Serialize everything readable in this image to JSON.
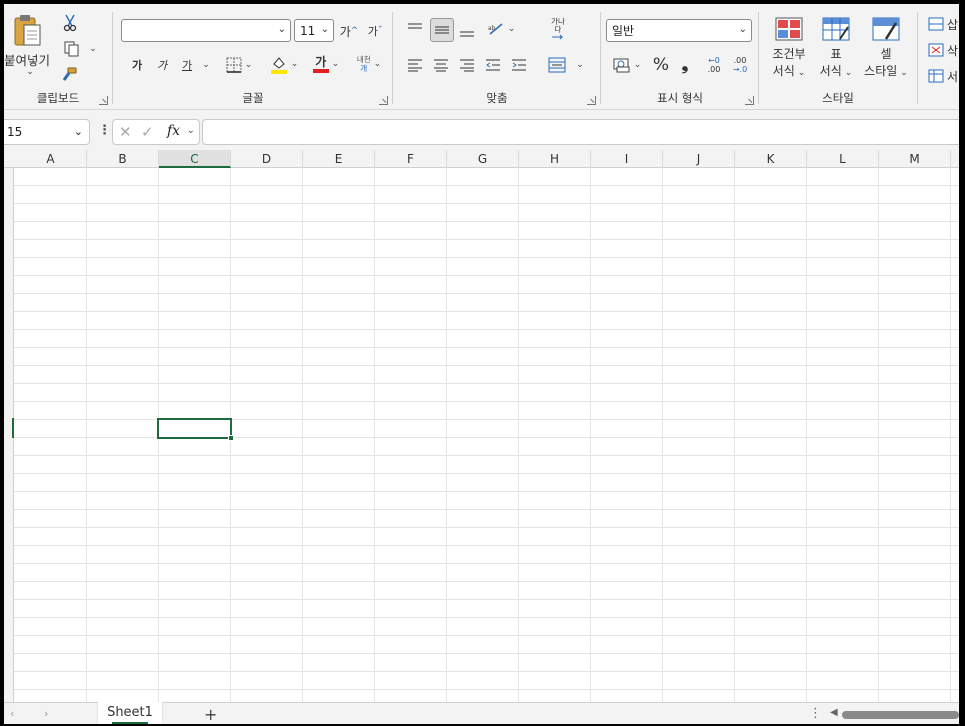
{
  "clipboard": {
    "paste_label": "붙여넣기",
    "group_label": "클립보드"
  },
  "font": {
    "family_value": "",
    "size_value": "11",
    "grow_label": "가",
    "shrink_label": "가",
    "bold_label": "가",
    "italic_label": "가",
    "underline_label": "가",
    "fontcolor_label": "가",
    "phonetic_label": "내천",
    "group_label": "글꼴"
  },
  "alignment": {
    "wrap_label": "가나다",
    "group_label": "맞춤"
  },
  "number": {
    "format_value": "일반",
    "percent_label": "%",
    "comma_label": "❟",
    "inc_decimal_label": ".00",
    "dec_decimal_label": ".0",
    "group_label": "표시 형식"
  },
  "styles": {
    "conditional_label_1": "조건부",
    "conditional_label_2": "서식",
    "table_label_1": "표",
    "table_label_2": "서식",
    "cell_label_1": "셀",
    "cell_label_2": "스타일",
    "group_label": "스타일"
  },
  "cells": {
    "insert_label": "삽",
    "delete_label": "삭",
    "format_label": "서"
  },
  "formula_bar": {
    "name_box_value": "15",
    "formula_value": "",
    "fx_label": "fx"
  },
  "columns": [
    "A",
    "B",
    "C",
    "D",
    "E",
    "F",
    "G",
    "H",
    "I",
    "J",
    "K",
    "L",
    "M"
  ],
  "selected_column": "C",
  "sheets": {
    "active_tab": "Sheet1",
    "add_label": "+"
  },
  "colors": {
    "accent": "#1e6b41",
    "fill_yellow": "#ffe600",
    "font_red": "#e0201b"
  }
}
